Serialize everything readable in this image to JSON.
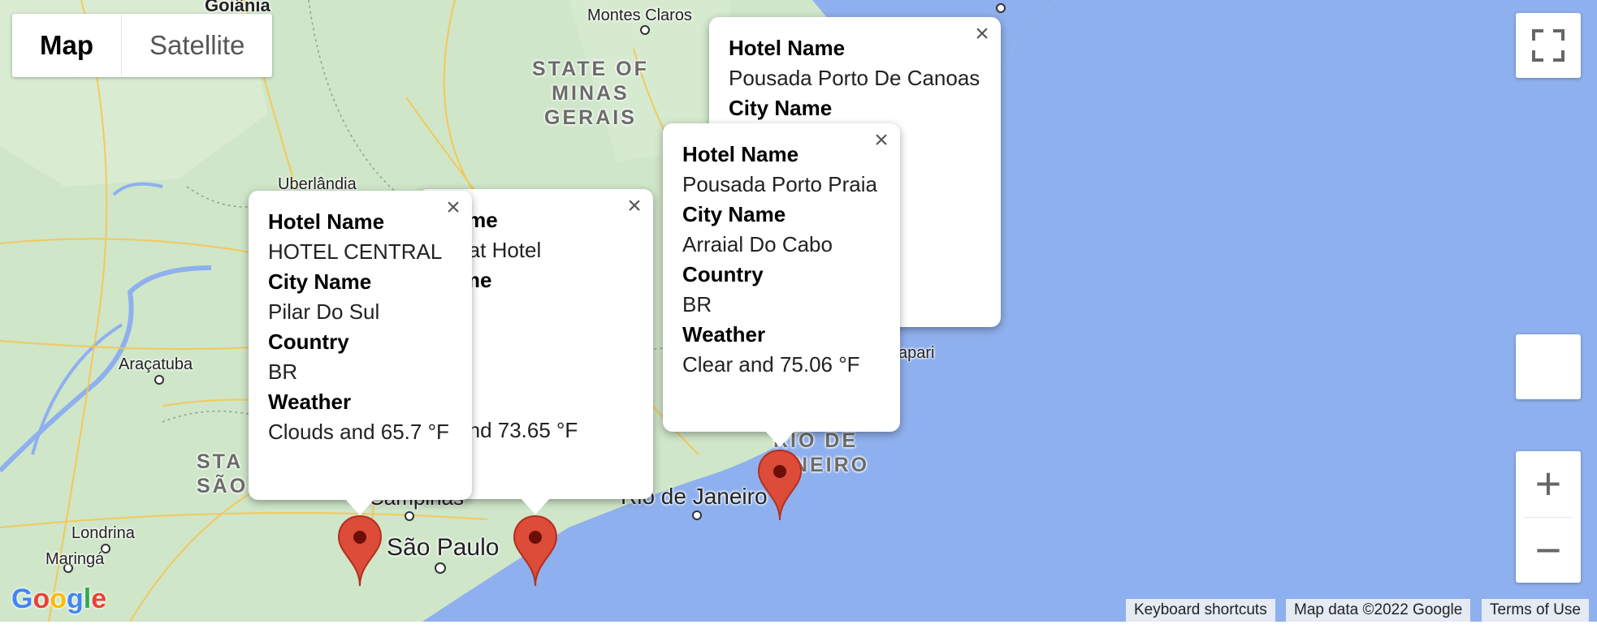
{
  "map_type": {
    "map_label": "Map",
    "satellite_label": "Satellite"
  },
  "colors": {
    "land": "#cfe6c9",
    "water": "#8fb0ee",
    "marker": "#dd4b39",
    "road": "#f7c54e"
  },
  "labels": {
    "goiania": "Goiânia",
    "montes_claros": "Montes Claros",
    "uberlandia": "Uberlândia",
    "aracatuba": "Araçatuba",
    "londrina": "Londrina",
    "maringa": "Maringá",
    "campinas": "Campinas",
    "sao_paulo": "São Paulo",
    "rio_de_janeiro": "Rio de Janeiro",
    "itapari": "apari",
    "minas_l1": "STATE OF",
    "minas_l2": "MINAS",
    "minas_l3": "GERAIS",
    "sp_l1": "STA",
    "sp_l2": "SÃO",
    "rj_l1": "RIO DE",
    "rj_l2": "JANEIRO"
  },
  "info_windows": [
    {
      "hotel_label": "Hotel Name",
      "hotel": "HOTEL CENTRAL",
      "city_label": "City Name",
      "city": "Pilar Do Sul",
      "country_label": "Country",
      "country": "BR",
      "weather_label": "Weather",
      "weather": "Clouds and 65.7 °F"
    },
    {
      "hotel_label": "el Name",
      "hotel": "Flat Hotel",
      "city_label": "y Name",
      "city": "bela",
      "country_label": "untry",
      "country": "",
      "weather_label": "ather",
      "weather": "uds and 73.65 °F"
    },
    {
      "hotel_label": "Hotel Name",
      "hotel": "Pousada Porto Praia",
      "city_label": "City Name",
      "city": "Arraial Do Cabo",
      "country_label": "Country",
      "country": "BR",
      "weather_label": "Weather",
      "weather": "Clear and 75.06 °F"
    },
    {
      "hotel_label": "Hotel Name",
      "hotel": "Pousada Porto De Canoas",
      "city_label": "City Name"
    }
  ],
  "close_glyph": "×",
  "zoom": {
    "in": "+",
    "out": "−"
  },
  "footer": {
    "shortcuts": "Keyboard shortcuts",
    "map_data": "Map data ©2022 Google",
    "terms": "Terms of Use"
  },
  "logo": "Google"
}
